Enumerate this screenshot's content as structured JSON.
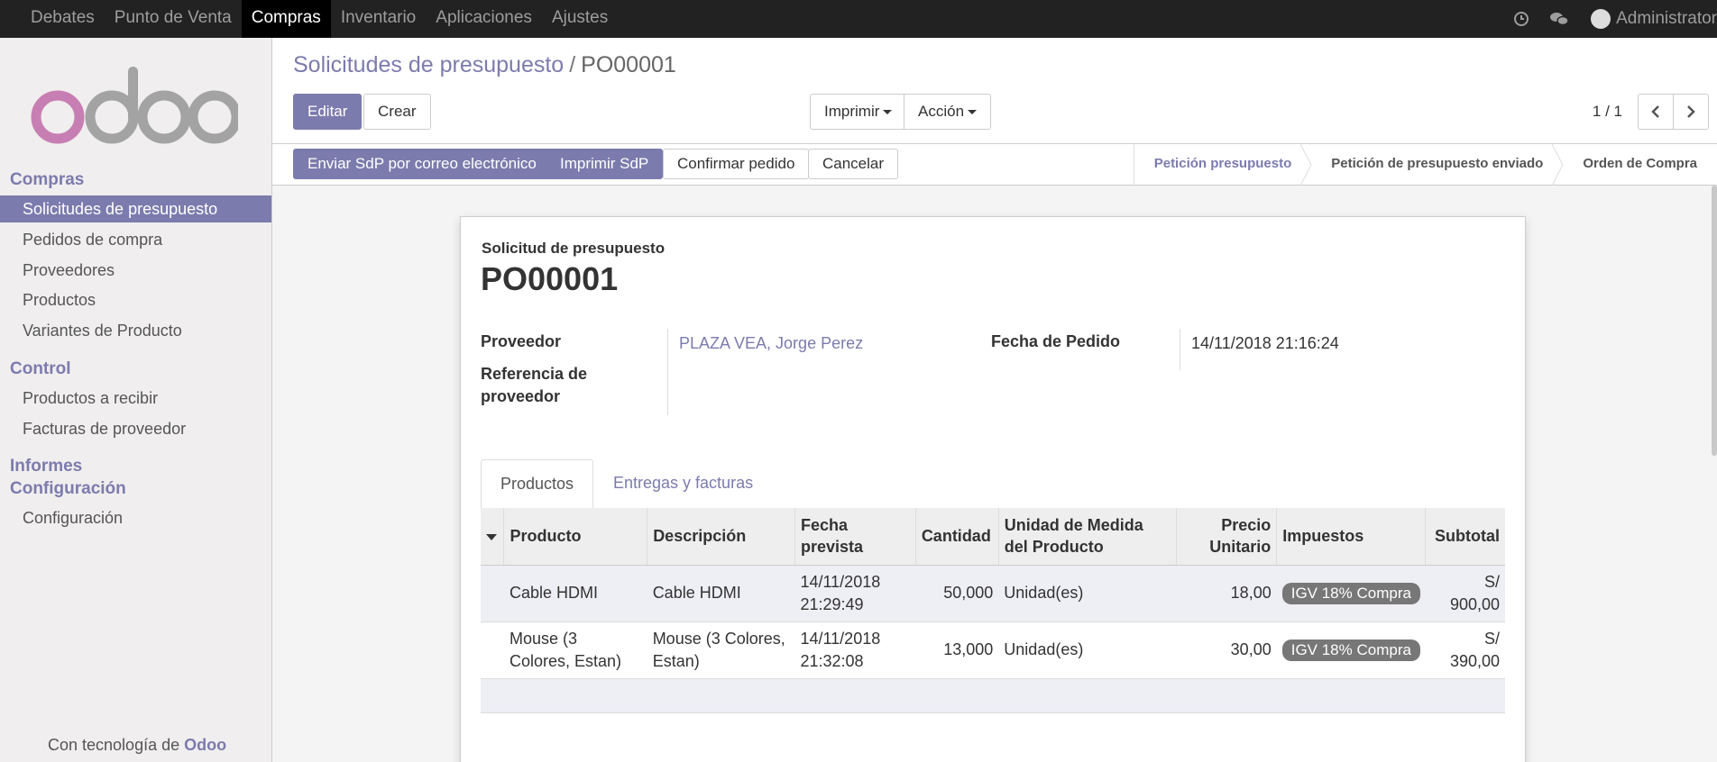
{
  "topbar": {
    "menus": [
      "Debates",
      "Punto de Venta",
      "Compras",
      "Inventario",
      "Aplicaciones",
      "Ajustes"
    ],
    "active_menu": "Compras",
    "user": "Administrator"
  },
  "sidebar": {
    "sections": [
      {
        "title": "Compras",
        "items": [
          "Solicitudes de presupuesto",
          "Pedidos de compra",
          "Proveedores",
          "Productos",
          "Variantes de Producto"
        ]
      },
      {
        "title": "Control",
        "items": [
          "Productos a recibir",
          "Facturas de proveedor"
        ]
      },
      {
        "title": "Informes",
        "items": []
      },
      {
        "title": "Configuración",
        "items": [
          "Configuración"
        ]
      }
    ],
    "active_item": "Solicitudes de presupuesto",
    "powered_prefix": "Con tecnología de",
    "powered_brand": "Odoo"
  },
  "control_panel": {
    "breadcrumb_parent": "Solicitudes de presupuesto",
    "breadcrumb_sep": "/",
    "breadcrumb_current": "PO00001",
    "edit_label": "Editar",
    "create_label": "Crear",
    "print_label": "Imprimir",
    "action_label": "Acción",
    "pager": "1 / 1"
  },
  "statusbar": {
    "buttons": [
      "Enviar SdP por correo electrónico",
      "Imprimir SdP",
      "Confirmar pedido",
      "Cancelar"
    ],
    "steps": [
      "Petición presupuesto",
      "Petición de presupuesto enviado",
      "Orden de Compra"
    ],
    "active_step": "Petición presupuesto"
  },
  "form": {
    "doc_label": "Solicitud de presupuesto",
    "doc_name": "PO00001",
    "vendor_label": "Proveedor",
    "vendor_value": "PLAZA VEA, Jorge Perez",
    "vendor_ref_label_1": "Referencia de",
    "vendor_ref_label_2": "proveedor",
    "order_date_label": "Fecha de Pedido",
    "order_date_value": "14/11/2018 21:16:24",
    "tabs": [
      "Productos",
      "Entregas y facturas"
    ],
    "active_tab": "Productos"
  },
  "lines": {
    "columns": {
      "product": "Producto",
      "description": "Descripción",
      "date_1": "Fecha",
      "date_2": "prevista",
      "qty": "Cantidad",
      "uom_1": "Unidad de Medida",
      "uom_2": "del Producto",
      "price_1": "Precio",
      "price_2": "Unitario",
      "taxes": "Impuestos",
      "subtotal": "Subtotal"
    },
    "rows": [
      {
        "product_1": "Cable HDMI",
        "product_2": "",
        "description_1": "Cable HDMI",
        "description_2": "",
        "date_1": "14/11/2018",
        "date_2": "21:29:49",
        "qty": "50,000",
        "uom": "Unidad(es)",
        "price": "18,00",
        "tax": "IGV 18% Compra",
        "subtotal": "S/ 900,00"
      },
      {
        "product_1": "Mouse (3",
        "product_2": "Colores, Estan)",
        "description_1": "Mouse (3 Colores,",
        "description_2": "Estan)",
        "date_1": "14/11/2018",
        "date_2": "21:32:08",
        "qty": "13,000",
        "uom": "Unidad(es)",
        "price": "30,00",
        "tax": "IGV 18% Compra",
        "subtotal": "S/ 390,00"
      }
    ]
  },
  "colors": {
    "brand": "#7c7bad",
    "topbar": "#222222",
    "tag": "#777777"
  }
}
